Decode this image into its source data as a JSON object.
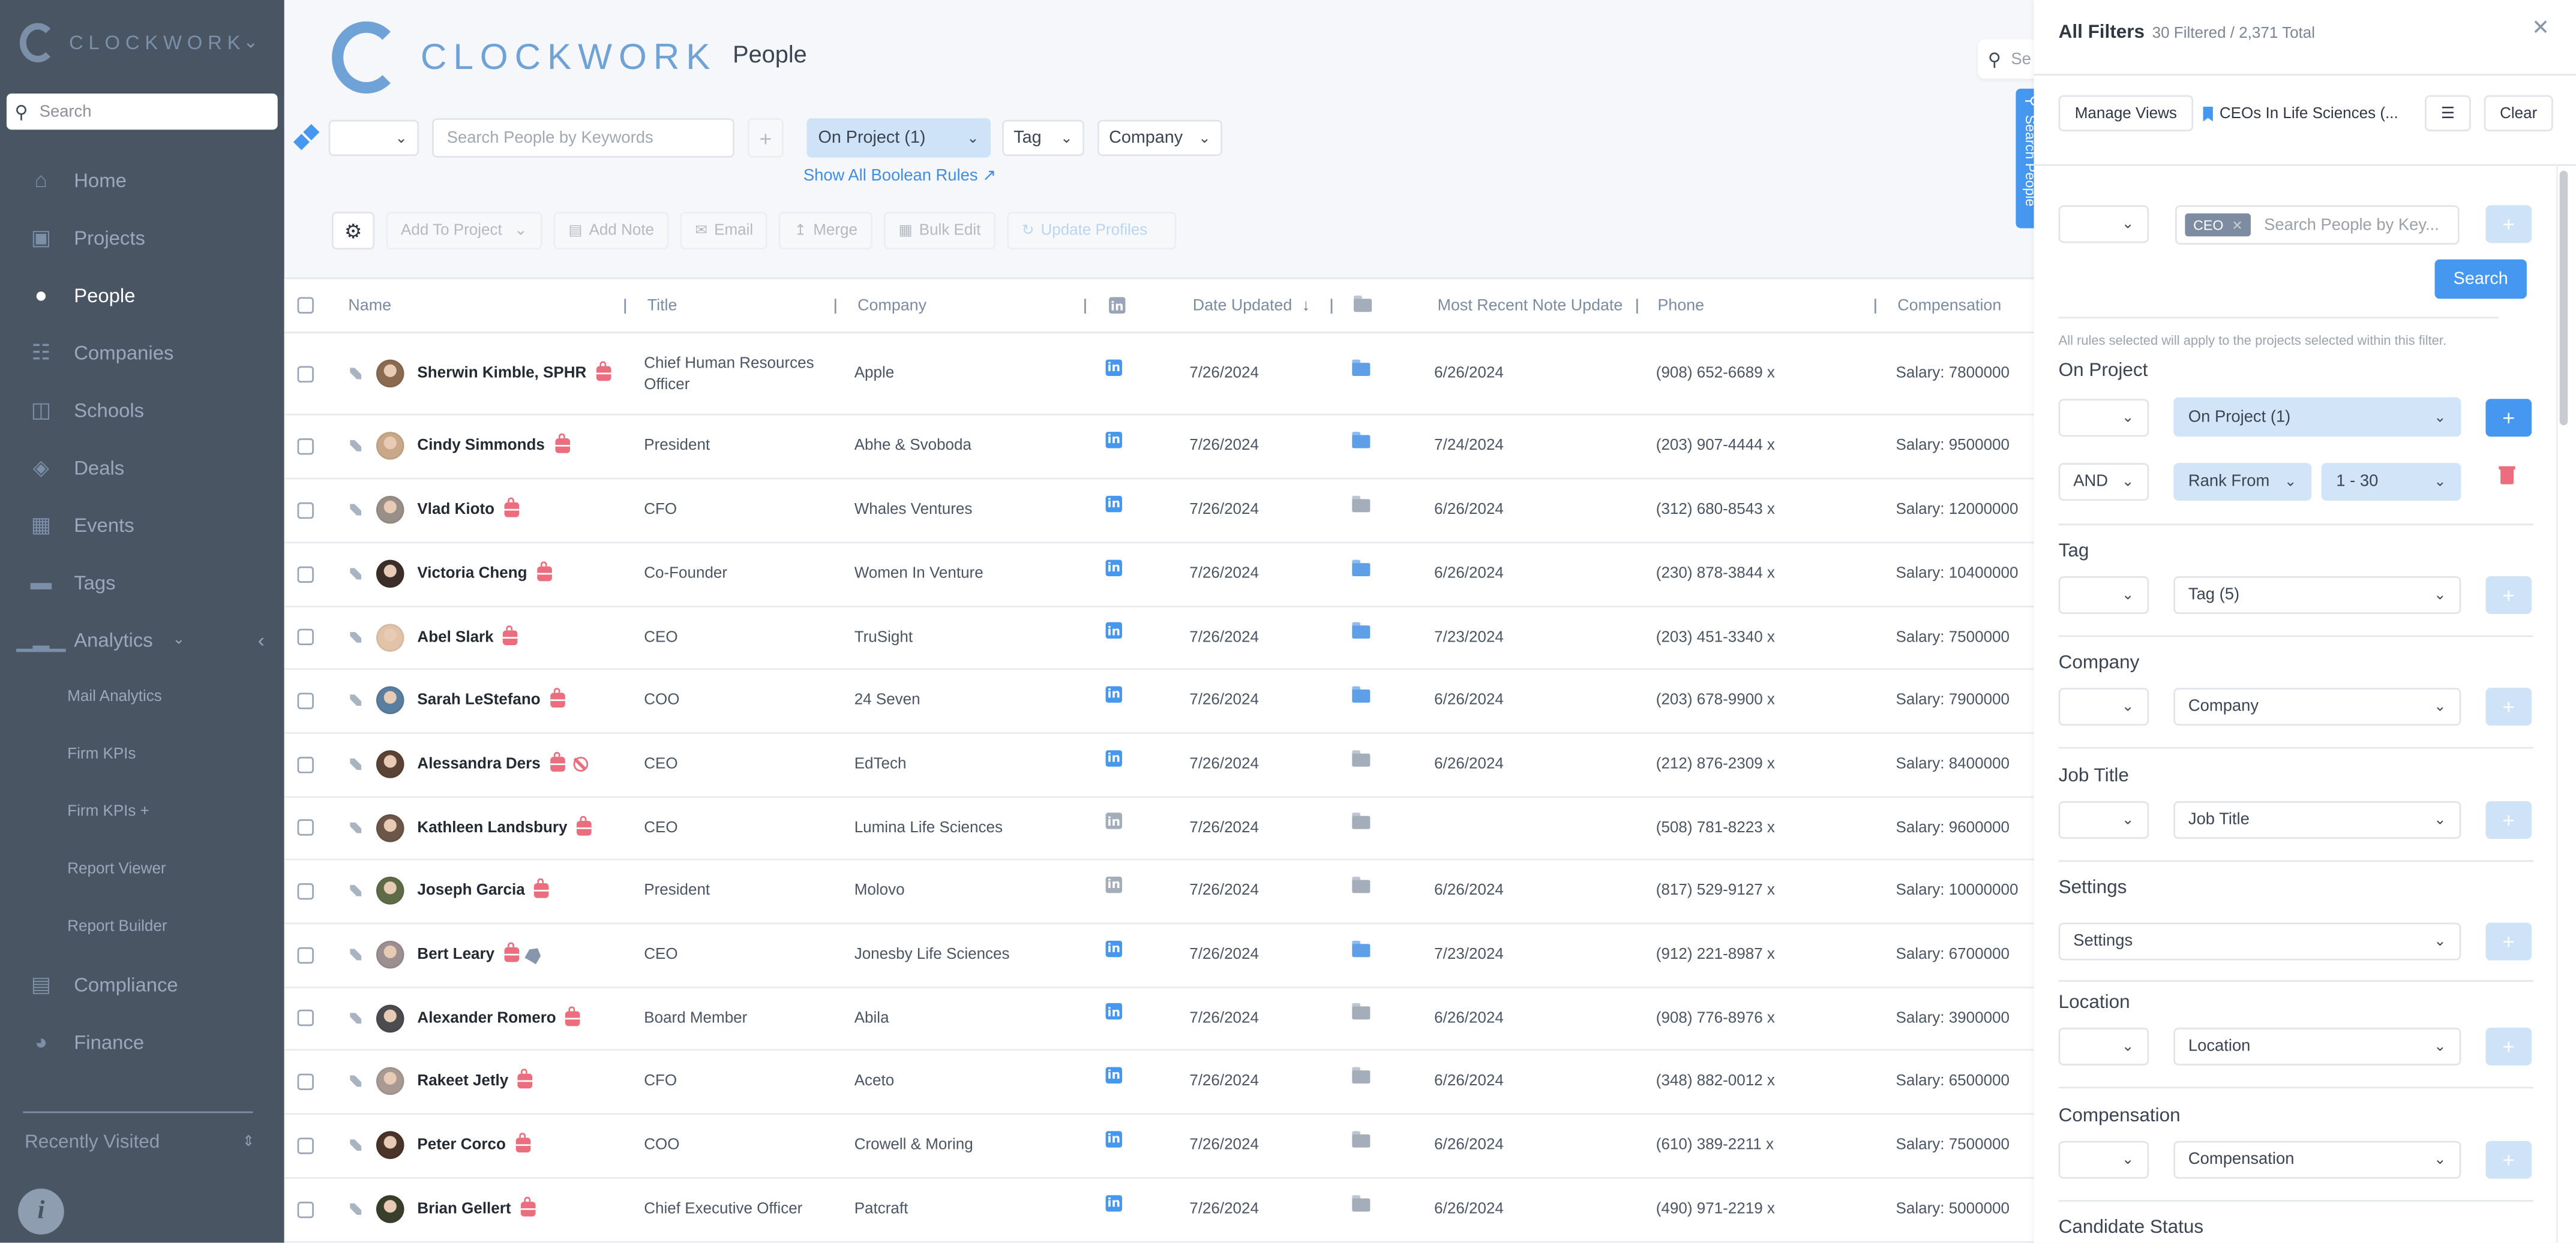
{
  "sidebar": {
    "brand": "CLOCKWORK",
    "search_placeholder": "Search",
    "items": [
      {
        "label": "Home",
        "icon": "home-icon",
        "active": false
      },
      {
        "label": "Projects",
        "icon": "briefcase-icon",
        "active": false
      },
      {
        "label": "People",
        "icon": "user-circle-icon",
        "active": true
      },
      {
        "label": "Companies",
        "icon": "org-chart-icon",
        "active": false
      },
      {
        "label": "Schools",
        "icon": "book-icon",
        "active": false
      },
      {
        "label": "Deals",
        "icon": "tag-icon",
        "active": false
      },
      {
        "label": "Events",
        "icon": "calendar-icon",
        "active": false
      },
      {
        "label": "Tags",
        "icon": "label-icon",
        "active": false
      },
      {
        "label": "Analytics",
        "icon": "bar-chart-icon",
        "active": false
      }
    ],
    "analytics_sub": [
      "Mail Analytics",
      "Firm KPIs",
      "Firm KPIs +",
      "Report Viewer",
      "Report Builder"
    ],
    "bottom_items": [
      {
        "label": "Compliance",
        "icon": "document-icon"
      },
      {
        "label": "Finance",
        "icon": "finance-icon"
      }
    ],
    "recently_visited": "Recently Visited"
  },
  "header": {
    "brand": "CLOCKWORK",
    "page_title": "People",
    "top_search_placeholder": "Se"
  },
  "filter_bar": {
    "keyword_placeholder": "Search People by Keywords",
    "plus": "+",
    "on_project": "On Project (1)",
    "tag": "Tag",
    "company": "Company",
    "show_boolean": "Show All Boolean Rules ↗"
  },
  "actions": {
    "add_to_project": "Add To Project",
    "add_note": "Add Note",
    "email": "Email",
    "merge": "Merge",
    "bulk_edit": "Bulk Edit",
    "update_profiles": "Update Profiles"
  },
  "table": {
    "columns": {
      "name": "Name",
      "title": "Title",
      "company": "Company",
      "date_updated": "Date Updated",
      "note_update": "Most Recent Note Update",
      "phone": "Phone",
      "compensation": "Compensation"
    },
    "sort_indicator": "↓",
    "rows": [
      {
        "name": "Sherwin Kimble, SPHR",
        "title": "Chief Human Resources Officer",
        "company": "Apple",
        "linkedin": true,
        "date_updated": "7/26/2024",
        "folder": true,
        "note_update": "6/26/2024",
        "phone": "(908) 652-6689 x",
        "compensation": "Salary: 7800000",
        "flags": [
          "bag"
        ],
        "avatar": "#8a6b52"
      },
      {
        "name": "Cindy Simmonds",
        "title": "President",
        "company": "Abhe & Svoboda",
        "linkedin": true,
        "date_updated": "7/26/2024",
        "folder": true,
        "note_update": "7/24/2024",
        "phone": "(203) 907-4444 x",
        "compensation": "Salary: 9500000",
        "flags": [
          "bag"
        ],
        "avatar": "#c9a88a"
      },
      {
        "name": "Vlad Kioto",
        "title": "CFO",
        "company": "Whales Ventures",
        "linkedin": true,
        "date_updated": "7/26/2024",
        "folder": false,
        "note_update": "6/26/2024",
        "phone": "(312) 680-8543 x",
        "compensation": "Salary: 12000000",
        "flags": [
          "bag"
        ],
        "avatar": "#9a8f88"
      },
      {
        "name": "Victoria Cheng",
        "title": "Co-Founder",
        "company": "Women In Venture",
        "linkedin": true,
        "date_updated": "7/26/2024",
        "folder": true,
        "note_update": "6/26/2024",
        "phone": "(230) 878-3844 x",
        "compensation": "Salary: 10400000",
        "flags": [
          "bag"
        ],
        "avatar": "#3b2e2a"
      },
      {
        "name": "Abel Slark",
        "title": "CEO",
        "company": "TruSight",
        "linkedin": true,
        "date_updated": "7/26/2024",
        "folder": true,
        "note_update": "7/23/2024",
        "phone": "(203) 451-3340 x",
        "compensation": "Salary: 7500000",
        "flags": [
          "bag"
        ],
        "avatar": "#e2c3a8"
      },
      {
        "name": "Sarah LeStefano",
        "title": "COO",
        "company": "24 Seven",
        "linkedin": true,
        "date_updated": "7/26/2024",
        "folder": true,
        "note_update": "6/26/2024",
        "phone": "(203) 678-9900 x",
        "compensation": "Salary: 7900000",
        "flags": [
          "bag"
        ],
        "avatar": "#5a7ea0"
      },
      {
        "name": "Alessandra Ders",
        "title": "CEO",
        "company": "EdTech",
        "linkedin": true,
        "date_updated": "7/26/2024",
        "folder": false,
        "note_update": "6/26/2024",
        "phone": "(212) 876-2309 x",
        "compensation": "Salary: 8400000",
        "flags": [
          "bag",
          "blocked"
        ],
        "avatar": "#5b4236"
      },
      {
        "name": "Kathleen Landsbury",
        "title": "CEO",
        "company": "Lumina Life Sciences",
        "linkedin": false,
        "date_updated": "7/26/2024",
        "folder": false,
        "note_update": "",
        "phone": "(508) 781-8223 x",
        "compensation": "Salary: 9600000",
        "flags": [
          "bag"
        ],
        "avatar": "#6b5647"
      },
      {
        "name": "Joseph Garcia",
        "title": "President",
        "company": "Molovo",
        "linkedin": false,
        "date_updated": "7/26/2024",
        "folder": false,
        "note_update": "6/26/2024",
        "phone": "(817) 529-9127 x",
        "compensation": "Salary: 10000000",
        "flags": [
          "bag"
        ],
        "avatar": "#5f6b48"
      },
      {
        "name": "Bert Leary",
        "title": "CEO",
        "company": "Jonesby Life Sciences",
        "linkedin": true,
        "date_updated": "7/26/2024",
        "folder": true,
        "note_update": "7/23/2024",
        "phone": "(912) 221-8987 x",
        "compensation": "Salary: 6700000",
        "flags": [
          "bag",
          "tag"
        ],
        "avatar": "#9c8f92"
      },
      {
        "name": "Alexander Romero",
        "title": "Board Member",
        "company": "Abila",
        "linkedin": true,
        "date_updated": "7/26/2024",
        "folder": false,
        "note_update": "6/26/2024",
        "phone": "(908) 776-8976 x",
        "compensation": "Salary: 3900000",
        "flags": [
          "bag"
        ],
        "avatar": "#4b4b50"
      },
      {
        "name": "Rakeet Jetly",
        "title": "CFO",
        "company": "Aceto",
        "linkedin": true,
        "date_updated": "7/26/2024",
        "folder": false,
        "note_update": "6/26/2024",
        "phone": "(348) 882-0012 x",
        "compensation": "Salary: 6500000",
        "flags": [
          "bag"
        ],
        "avatar": "#a89a92"
      },
      {
        "name": "Peter Corco",
        "title": "COO",
        "company": "Crowell & Moring",
        "linkedin": true,
        "date_updated": "7/26/2024",
        "folder": false,
        "note_update": "6/26/2024",
        "phone": "(610) 389-2211 x",
        "compensation": "Salary: 7500000",
        "flags": [
          "bag"
        ],
        "avatar": "#4a3328"
      },
      {
        "name": "Brian Gellert",
        "title": "Chief Executive Officer",
        "company": "Patcraft",
        "linkedin": true,
        "date_updated": "7/26/2024",
        "folder": false,
        "note_update": "6/26/2024",
        "phone": "(490) 971-2219 x",
        "compensation": "Salary: 5000000",
        "flags": [
          "bag"
        ],
        "avatar": "#3a3f2c"
      }
    ]
  },
  "panel": {
    "search_tab": "Search People",
    "title": "All Filters",
    "count": "30 Filtered / 2,371 Total",
    "manage_views": "Manage Views",
    "view_name": "CEOs In Life Sciences (...",
    "clear": "Clear",
    "keyword_chip": "CEO",
    "keyword_placeholder": "Search People by Key...",
    "search_btn": "Search",
    "hint": "All rules selected will apply to the projects selected within this filter.",
    "on_project": {
      "title": "On Project",
      "value": "On Project (1)",
      "operator2": "AND",
      "rank_label": "Rank From",
      "rank_value": "1 - 30"
    },
    "sections": [
      {
        "title": "Tag",
        "value": "Tag (5)",
        "has_operator": true
      },
      {
        "title": "Company",
        "value": "Company",
        "has_operator": true
      },
      {
        "title": "Job Title",
        "value": "Job Title",
        "has_operator": true
      },
      {
        "title": "Settings",
        "value": "Settings",
        "has_operator": false
      },
      {
        "title": "Location",
        "value": "Location",
        "has_operator": true
      },
      {
        "title": "Compensation",
        "value": "Compensation",
        "has_operator": true
      }
    ],
    "last_section": "Candidate Status"
  },
  "colors": {
    "accent": "#4597ef",
    "sidebar_bg": "#4a5564",
    "danger": "#ea6e7e",
    "active_filter_bg": "#cfe3f8"
  }
}
